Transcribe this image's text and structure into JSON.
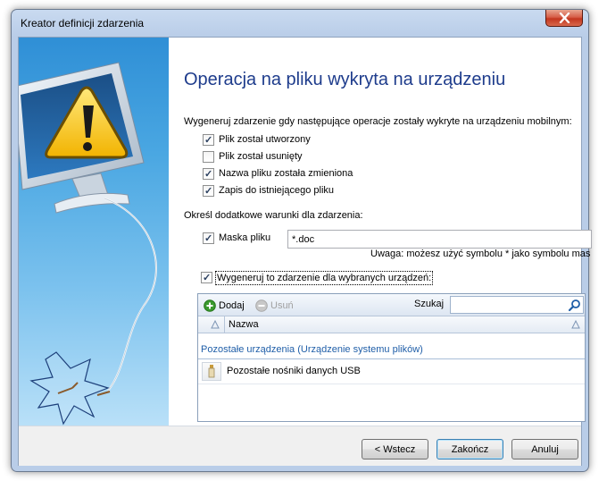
{
  "window": {
    "title": "Kreator definicji zdarzenia"
  },
  "heading": "Operacja na pliku wykryta na urządzeniu",
  "intro": "Wygeneruj zdarzenie gdy następujące operacje zostały wykryte na urządzeniu mobilnym:",
  "operations": [
    {
      "label": "Plik został utworzony",
      "checked": true
    },
    {
      "label": "Plik został usunięty",
      "checked": false
    },
    {
      "label": "Nazwa pliku została zmieniona",
      "checked": true
    },
    {
      "label": "Zapis do  istniejącego pliku",
      "checked": true
    }
  ],
  "conditions_label": "Określ dodatkowe warunki dla zdarzenia:",
  "mask": {
    "label": "Maska pliku",
    "checked": true,
    "value": "*.doc"
  },
  "hint": "Uwaga: możesz użyć symbolu * jako symbolu mas",
  "devices_option": {
    "label": "Wygeneruj to zdarzenie dla wybranych urządzeń:",
    "checked": true
  },
  "toolbar": {
    "add": "Dodaj",
    "remove": "Usuń",
    "search_label": "Szukaj",
    "search_value": ""
  },
  "table": {
    "column": "Nazwa",
    "group": "Pozostałe urządzenia (Urządzenie systemu plików)",
    "rows": [
      {
        "name": "Pozostałe nośniki danych USB"
      }
    ]
  },
  "buttons": {
    "back": "< Wstecz",
    "finish": "Zakończ",
    "cancel": "Anuluj"
  },
  "colors": {
    "heading": "#1e3c8c",
    "group_text": "#1f5ea8",
    "add_icon": "#3a9a2e"
  },
  "icons": [
    "close-icon",
    "monitor-icon",
    "warning-icon",
    "add-icon",
    "remove-icon",
    "search-icon",
    "sort-icon",
    "usb-drive-icon"
  ]
}
